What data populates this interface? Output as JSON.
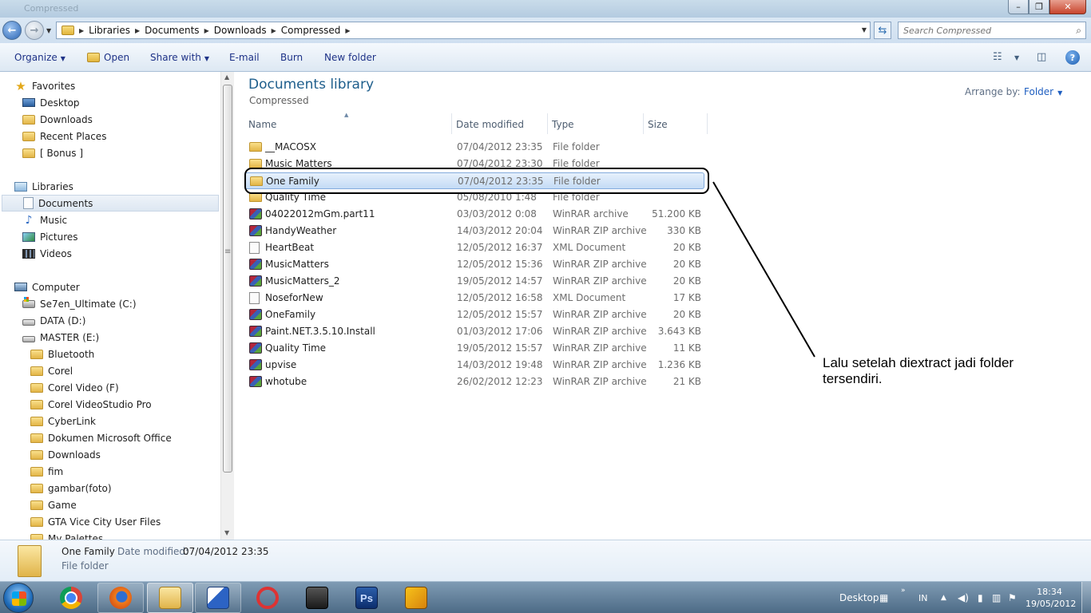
{
  "window": {
    "title_text": "Compressed",
    "min_glyph": "–",
    "max_glyph": "❐",
    "close_glyph": "✕"
  },
  "address": {
    "crumbs": [
      "Libraries",
      "Documents",
      "Downloads",
      "Compressed"
    ],
    "search_placeholder": "Search Compressed"
  },
  "toolbar": {
    "organize": "Organize",
    "open": "Open",
    "share_with": "Share with",
    "email": "E-mail",
    "burn": "Burn",
    "new_folder": "New folder",
    "help_glyph": "?"
  },
  "nav": {
    "favorites": "Favorites",
    "desktop": "Desktop",
    "downloads": "Downloads",
    "recent_places": "Recent Places",
    "bonus": "[ Bonus ]",
    "libraries": "Libraries",
    "documents": "Documents",
    "music": "Music",
    "pictures": "Pictures",
    "videos": "Videos",
    "computer": "Computer",
    "drive_c": "Se7en_Ultimate (C:)",
    "drive_d": "DATA (D:)",
    "drive_e": "MASTER (E:)",
    "e_folders": [
      "Bluetooth",
      "Corel",
      "Corel Video (F)",
      "Corel VideoStudio Pro",
      "CyberLink",
      "Dokumen Microsoft Office",
      "Downloads",
      "fim",
      "gambar(foto)",
      "Game",
      "GTA Vice City User Files",
      "My Palettes"
    ]
  },
  "library": {
    "title": "Documents library",
    "subtitle": "Compressed",
    "arrange_label": "Arrange by:",
    "arrange_value": "Folder"
  },
  "columns": {
    "name": "Name",
    "date": "Date modified",
    "type": "Type",
    "size": "Size"
  },
  "files": [
    {
      "name": "__MACOSX",
      "date": "07/04/2012 23:35",
      "type": "File folder",
      "size": "",
      "icon": "folder-icon"
    },
    {
      "name": "Music Matters",
      "date": "07/04/2012 23:30",
      "type": "File folder",
      "size": "",
      "icon": "folder-icon"
    },
    {
      "name": "One Family",
      "date": "07/04/2012 23:35",
      "type": "File folder",
      "size": "",
      "icon": "folder-icon"
    },
    {
      "name": "Quality Time",
      "date": "05/08/2010 1:48",
      "type": "File folder",
      "size": "",
      "icon": "folder-icon"
    },
    {
      "name": "04022012mGm.part11",
      "date": "03/03/2012 0:08",
      "type": "WinRAR archive",
      "size": "51.200 KB",
      "icon": "winrar-icon"
    },
    {
      "name": "HandyWeather",
      "date": "14/03/2012 20:04",
      "type": "WinRAR ZIP archive",
      "size": "330 KB",
      "icon": "winrar-icon"
    },
    {
      "name": "HeartBeat",
      "date": "12/05/2012 16:37",
      "type": "XML Document",
      "size": "20 KB",
      "icon": "xml-document-icon"
    },
    {
      "name": "MusicMatters",
      "date": "12/05/2012 15:36",
      "type": "WinRAR ZIP archive",
      "size": "20 KB",
      "icon": "winrar-icon"
    },
    {
      "name": "MusicMatters_2",
      "date": "19/05/2012 14:57",
      "type": "WinRAR ZIP archive",
      "size": "20 KB",
      "icon": "winrar-icon"
    },
    {
      "name": "NoseforNew",
      "date": "12/05/2012 16:58",
      "type": "XML Document",
      "size": "17 KB",
      "icon": "xml-document-icon"
    },
    {
      "name": "OneFamily",
      "date": "12/05/2012 15:57",
      "type": "WinRAR ZIP archive",
      "size": "20 KB",
      "icon": "winrar-icon"
    },
    {
      "name": "Paint.NET.3.5.10.Install",
      "date": "01/03/2012 17:06",
      "type": "WinRAR ZIP archive",
      "size": "3.643 KB",
      "icon": "winrar-icon"
    },
    {
      "name": "Quality Time",
      "date": "19/05/2012 15:57",
      "type": "WinRAR ZIP archive",
      "size": "11 KB",
      "icon": "winrar-icon"
    },
    {
      "name": "upvise",
      "date": "14/03/2012 19:48",
      "type": "WinRAR ZIP archive",
      "size": "1.236 KB",
      "icon": "winrar-icon"
    },
    {
      "name": "whotube",
      "date": "26/02/2012 12:23",
      "type": "WinRAR ZIP archive",
      "size": "21 KB",
      "icon": "winrar-icon"
    }
  ],
  "selected_index": 2,
  "annotation": {
    "text": "Lalu setelah diextract jadi folder tersendiri."
  },
  "details": {
    "name": "One Family",
    "date_label": "Date modified:",
    "date_value": "07/04/2012 23:35",
    "type": "File folder"
  },
  "taskbar": {
    "ps_label": "Ps",
    "desktop_label": "Desktop",
    "lang": "IN",
    "time": "18:34",
    "date": "19/05/2012"
  },
  "colors": {
    "title_blue": "#1e5e8c",
    "command_text": "#1e3287",
    "selection_border": "#84acdd",
    "taskbar": "#5b7893"
  }
}
